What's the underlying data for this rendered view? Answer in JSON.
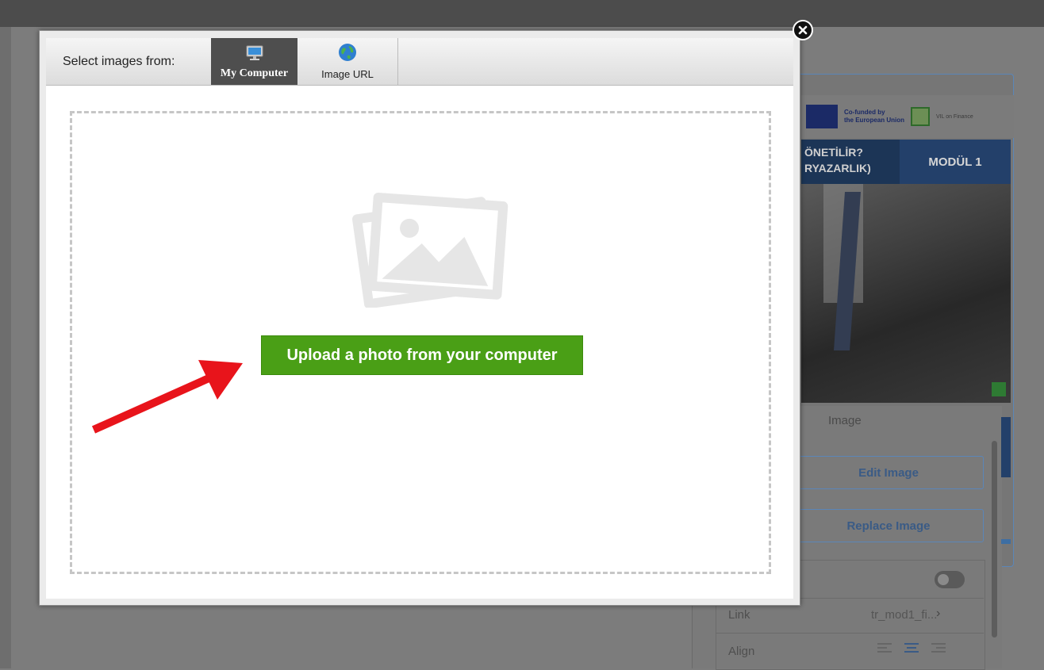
{
  "background_editor": {
    "logos": {
      "eu_text_line1": "Co-funded by",
      "eu_text_line2": "the European Union",
      "vil_text": "VIL on Finance"
    },
    "banner": {
      "left_line1": "ÖNETİLİR?",
      "left_line2": "RYAZARLIK)",
      "right": "MODÜL 1"
    },
    "panel": {
      "title": "Image",
      "edit_button": "Edit Image",
      "replace_button": "Replace Image",
      "link_label": "Link",
      "link_value": "tr_mod1_fi...",
      "align_label": "Align"
    }
  },
  "modal": {
    "select_label": "Select images from:",
    "tabs": [
      {
        "label": "My Computer",
        "icon": "monitor-icon",
        "active": true
      },
      {
        "label": "Image URL",
        "icon": "globe-icon",
        "active": false
      }
    ],
    "upload_button": "Upload a photo from your computer",
    "placeholder_icon": "image-placeholder-icon",
    "close_icon": "close-icon"
  },
  "colors": {
    "upload_green": "#4a9f16",
    "active_tab": "#4e4e4e",
    "annotation_arrow": "#e8141b"
  }
}
